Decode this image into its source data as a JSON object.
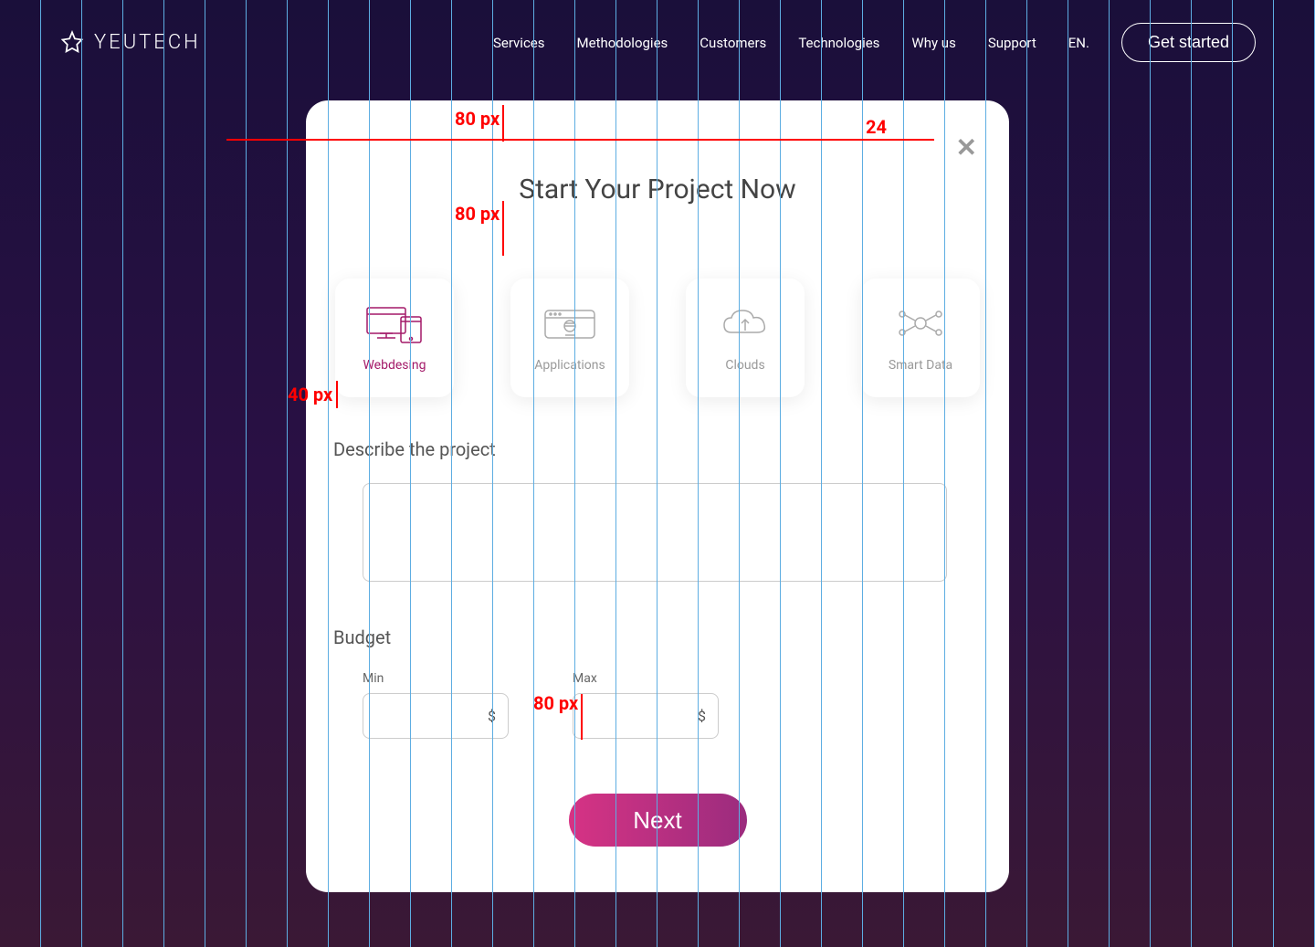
{
  "header": {
    "logo_text": "YEUTECH",
    "nav": {
      "services": "Services",
      "methodologies": "Methodologies",
      "customers": "Customers",
      "technologies": "Technologies",
      "why_us": "Why us",
      "support": "Support",
      "language": "EN."
    },
    "get_started": "Get started"
  },
  "modal": {
    "title": "Start Your Project Now",
    "categories": {
      "webdesign": "Webdesing",
      "applications": "Applications",
      "clouds": "Clouds",
      "smart_data": "Smart Data"
    },
    "describe_label": "Describe the project",
    "budget_label": "Budget",
    "budget_min": "Min",
    "budget_max": "Max",
    "currency": "$",
    "next_button": "Next"
  },
  "annotations": {
    "top_80": "80 px",
    "below_title_80": "80 px",
    "gap_40": "40 px",
    "bottom_80": "80 px",
    "twenty_four": "24"
  }
}
